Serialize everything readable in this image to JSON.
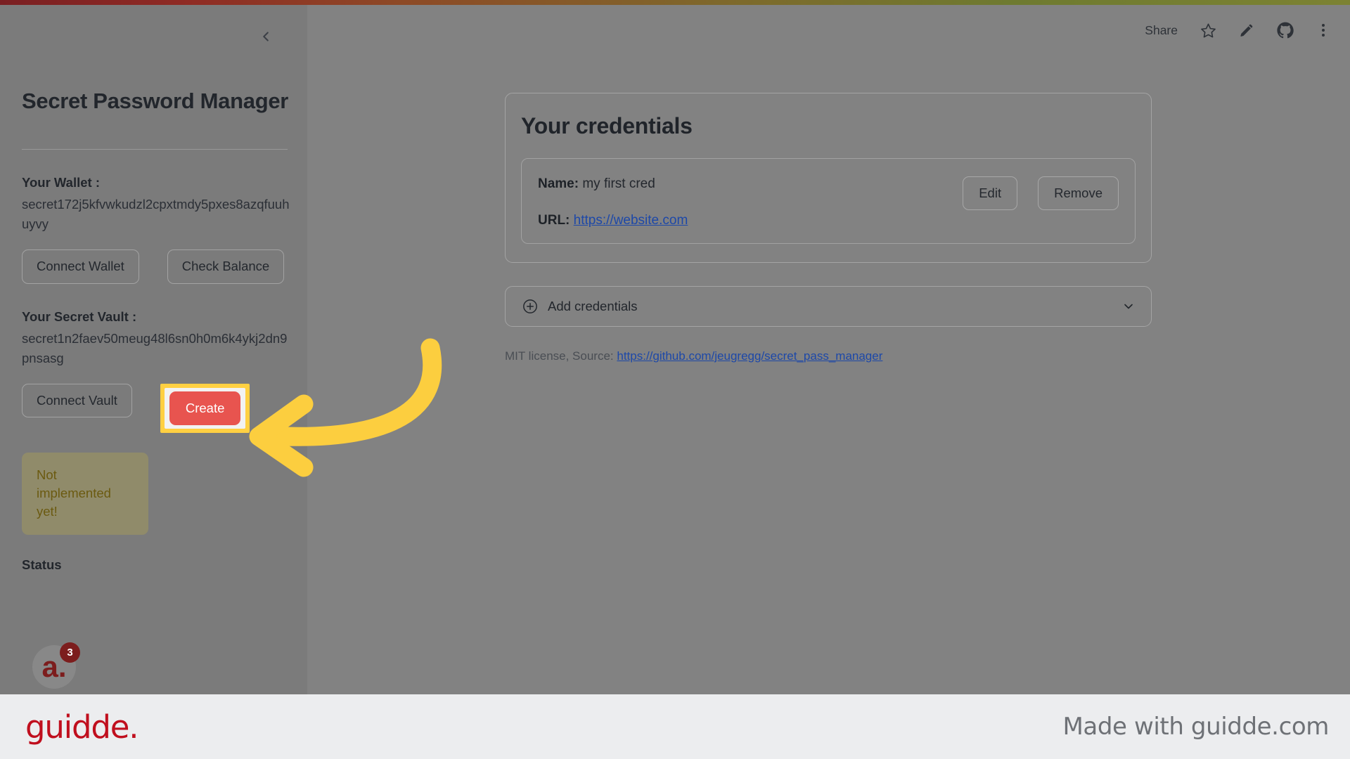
{
  "app": {
    "sidebar": {
      "collapse_icon": "chevron-left-icon",
      "title": "Secret Password Manager",
      "wallet_label": "Your Wallet :",
      "wallet_value": "secret172j5kfvwkudzl2cpxtmdy5pxes8azqfuuhuyvy",
      "connect_wallet_label": "Connect Wallet",
      "check_balance_label": "Check Balance",
      "vault_label": "Your Secret Vault :",
      "vault_value": "secret1n2faev50meug48l6sn0h0m6k4ykj2dn9pnsasg",
      "connect_vault_label": "Connect Vault",
      "create_label": "Create",
      "alert_text": "Not implemented yet!",
      "status_label": "Status",
      "avatar_letter": "a.",
      "avatar_badge_count": "3"
    },
    "topbar": {
      "share_label": "Share",
      "star_icon": "star-icon",
      "edit_icon": "pencil-icon",
      "github_icon": "github-icon",
      "more_icon": "kebab-menu-icon"
    },
    "main": {
      "card_title": "Your credentials",
      "credential": {
        "name_label": "Name:",
        "name_value": "my first cred",
        "url_label": "URL:",
        "url_value": "https://website.com",
        "edit_label": "Edit",
        "remove_label": "Remove"
      },
      "expander": {
        "plus_icon": "plus-circle-icon",
        "label": "Add credentials",
        "chevron_icon": "chevron-down-icon"
      },
      "license_prefix": "MIT license, Source:",
      "license_link": "https://github.com/jeugregg/secret_pass_manager"
    }
  },
  "annotation": {
    "arrow_color": "#FCCE3F",
    "highlight_color": "#FFD042",
    "target": "create-button"
  },
  "footer": {
    "logo_text": "guidde.",
    "made_with_text": "Made with guidde.com",
    "logo_color": "#C00F1E",
    "background": "#ECEDEF"
  }
}
